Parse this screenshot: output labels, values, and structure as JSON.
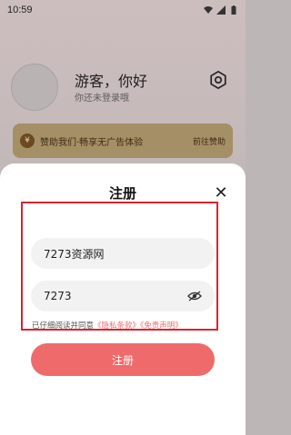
{
  "status_bar": {
    "time": "10:59"
  },
  "background": {
    "greeting": "游客，你好",
    "subtitle": "你还未登录哦",
    "donate_text": "赞助我们·畅享无广告体验",
    "donate_action": "前往赞助",
    "coin_symbol": "¥"
  },
  "register_sheet": {
    "title": "注册",
    "close_symbol": "✕",
    "username_value": "7273资源网",
    "password_value": "7273",
    "agreement_prefix": "已仔细阅读并同意",
    "privacy_link": "《隐私条款》",
    "disclaimer_link": "《免责声明》",
    "submit_label": "注册"
  },
  "colors": {
    "accent": "#ef6b6b",
    "highlight_box": "#d9252f",
    "link": "#f06b6b"
  }
}
